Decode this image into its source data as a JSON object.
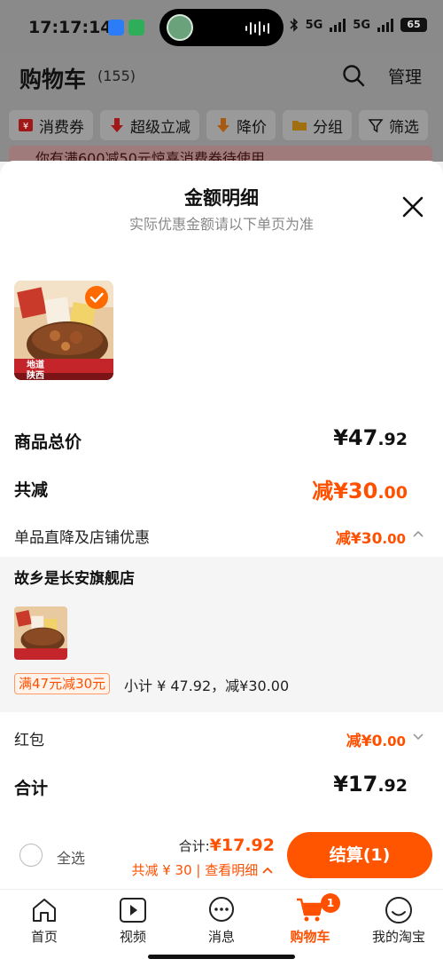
{
  "status_bar": {
    "time": "17:17:14",
    "net1": "5G",
    "net2": "5G",
    "battery": "65"
  },
  "header": {
    "title": "购物车",
    "count": "(155)",
    "manage": "管理"
  },
  "filters": [
    "消费券",
    "超级立减",
    "降价",
    "分组",
    "筛选"
  ],
  "banner": {
    "text": "你有满600减50元惊喜消费券待使用"
  },
  "sheet": {
    "title": "金额明细",
    "subtitle": "实际优惠金额请以下单页为准",
    "total_label": "商品总价",
    "total_int": "¥47",
    "total_dec": ".92",
    "reduce_label": "共减",
    "reduce_int": "减¥30",
    "reduce_dec": ".00",
    "direct_label": "单品直降及店铺优惠",
    "direct_int": "减¥30",
    "direct_dec": ".00",
    "store_name": "故乡是长安旗舰店",
    "promo_tag": "满47元减30元",
    "subtotal": "小计 ¥ 47.92，减¥30.00",
    "redpack_label": "红包",
    "redpack_int": "减¥0",
    "redpack_dec": ".00",
    "sum_label": "合计",
    "sum_int": "¥17",
    "sum_dec": ".92"
  },
  "product": {
    "image_text1": "地道",
    "image_text2": "陕西"
  },
  "checkout": {
    "select_all": "全选",
    "total_prefix": "合计:",
    "total_value": "¥17.92",
    "detail_link": "共减 ¥ 30 | 查看明细",
    "pay_button": "结算(1)"
  },
  "tabs": [
    {
      "label": "首页",
      "icon": "home-icon"
    },
    {
      "label": "视频",
      "icon": "video-icon"
    },
    {
      "label": "消息",
      "icon": "message-icon"
    },
    {
      "label": "购物车",
      "icon": "cart-icon",
      "active": true,
      "badge": "1"
    },
    {
      "label": "我的淘宝",
      "icon": "profile-icon"
    }
  ],
  "colors": {
    "accent": "#ff5000",
    "button": "#ff5500"
  }
}
